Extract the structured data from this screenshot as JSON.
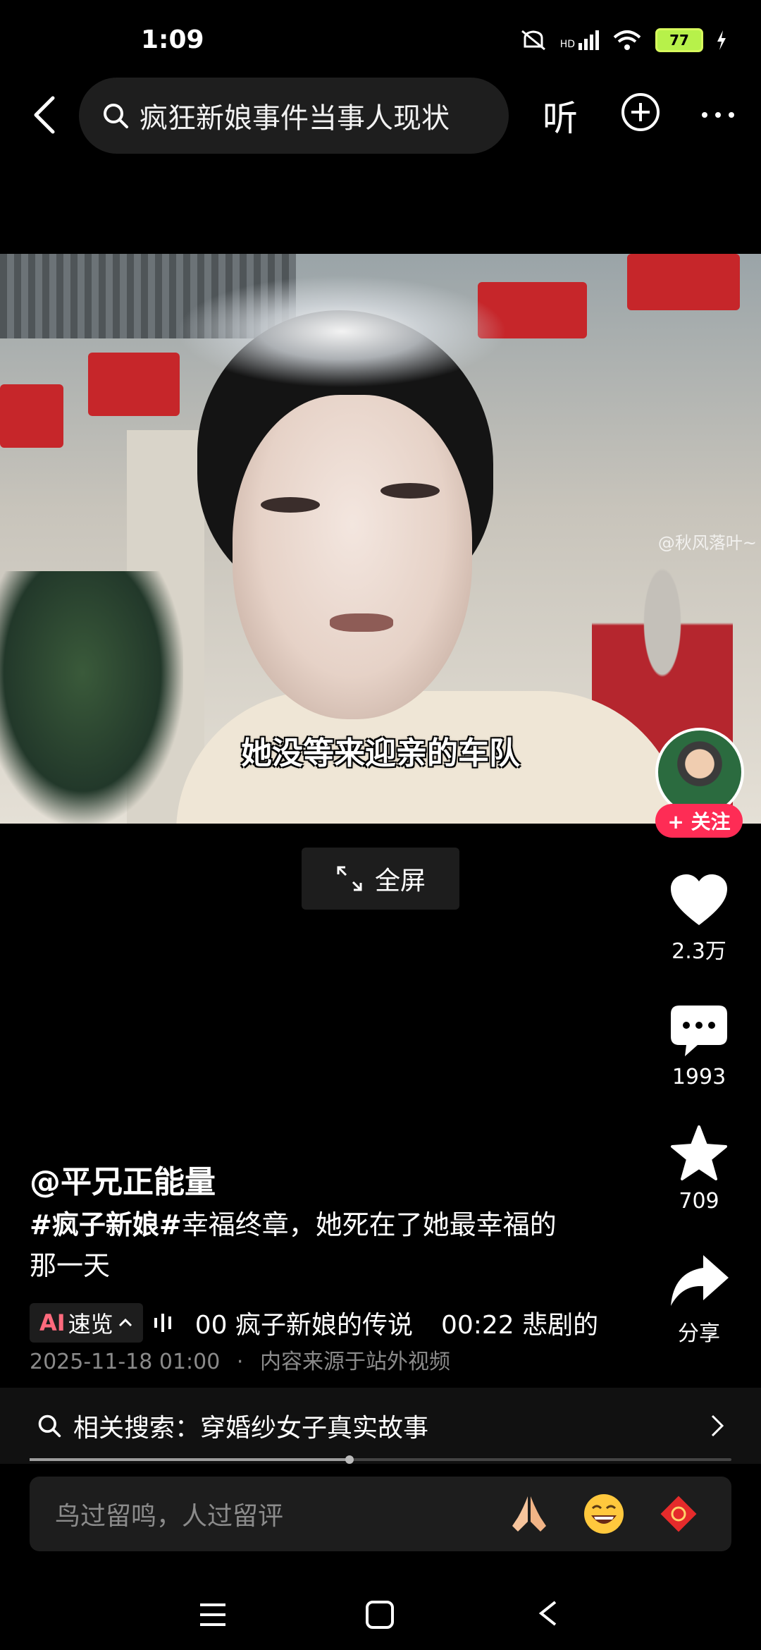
{
  "status_bar": {
    "time": "1:09",
    "network": "HD",
    "battery": "77"
  },
  "top_bar": {
    "search_text": "疯狂新娘事件当事人现状",
    "listen_label": "听"
  },
  "video": {
    "caption": "她没等来迎亲的车队",
    "watermark": "@秋风落叶~"
  },
  "fullscreen": {
    "label": "全屏"
  },
  "rail": {
    "follow_label": "+ 关注",
    "like_count": "2.3万",
    "comment_count": "1993",
    "favorite_count": "709",
    "share_label": "分享"
  },
  "post": {
    "author": "@平兄正能量",
    "hashtag": "#疯子新娘#",
    "desc_line1_rest": "幸福终章，她死在了她最幸福的",
    "desc_line2": "那一天",
    "ai_label_ai": "AI",
    "ai_label_rest": "速览",
    "chapters": [
      "00 疯子新娘的传说",
      "00:22 悲剧的"
    ],
    "date": "2025-11-18 01:00",
    "source": "内容来源于站外视频"
  },
  "related": {
    "text": "相关搜索：穿婚纱女子真实故事"
  },
  "comment": {
    "placeholder": "鸟过留鸣，人过留评"
  },
  "colors": {
    "accent_red": "#fe2c55",
    "battery_green": "#b7f14a"
  }
}
